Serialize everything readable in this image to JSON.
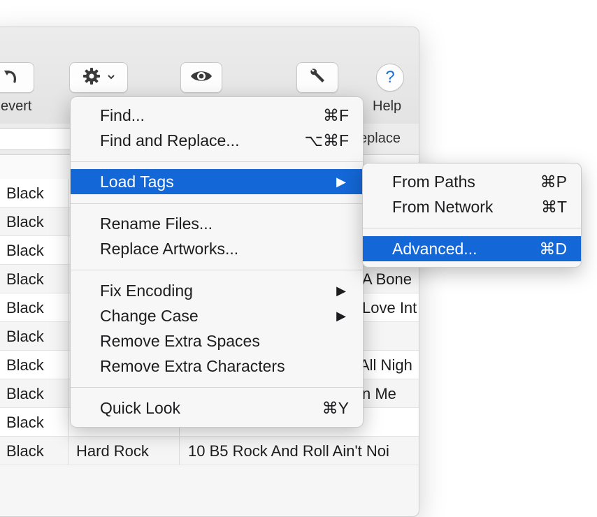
{
  "toolbar": {
    "revert_label": "evert",
    "help_label": "Help",
    "help_glyph": "?"
  },
  "search": {
    "replace_label": "eplace"
  },
  "table": {
    "rows": [
      {
        "c1": "Black",
        "c2": "",
        "c3": ""
      },
      {
        "c1": "Black",
        "c2": "",
        "c3": ""
      },
      {
        "c1": "Black",
        "c2": "",
        "c3": ""
      },
      {
        "c1": "Black",
        "c2": "",
        "c3": "A Bone"
      },
      {
        "c1": "Black",
        "c2": "",
        "c3": "Love Int"
      },
      {
        "c1": "Black",
        "c2": "",
        "c3": ""
      },
      {
        "c1": "Black",
        "c2": "",
        "c3": "All Nigh"
      },
      {
        "c1": "Black",
        "c2": "",
        "c3": "n Me"
      },
      {
        "c1": "Black",
        "c2": "",
        "c3": ""
      },
      {
        "c1": "Black",
        "c2": "Hard Rock",
        "c3": "10 B5 Rock And Roll Ain't Noi"
      }
    ]
  },
  "menu": {
    "find": {
      "label": "Find...",
      "shortcut": "⌘F"
    },
    "find_replace": {
      "label": "Find and Replace...",
      "shortcut": "⌥⌘F"
    },
    "load_tags": {
      "label": "Load Tags",
      "arrow": "▶"
    },
    "rename_files": {
      "label": "Rename Files..."
    },
    "replace_artworks": {
      "label": "Replace Artworks..."
    },
    "fix_encoding": {
      "label": "Fix Encoding",
      "arrow": "▶"
    },
    "change_case": {
      "label": "Change Case",
      "arrow": "▶"
    },
    "remove_spaces": {
      "label": "Remove Extra Spaces"
    },
    "remove_chars": {
      "label": "Remove Extra Characters"
    },
    "quick_look": {
      "label": "Quick Look",
      "shortcut": "⌘Y"
    }
  },
  "submenu": {
    "from_paths": {
      "label": "From Paths",
      "shortcut": "⌘P"
    },
    "from_network": {
      "label": "From Network",
      "shortcut": "⌘T"
    },
    "advanced": {
      "label": "Advanced...",
      "shortcut": "⌘D"
    }
  },
  "colors": {
    "highlight": "#1467d6",
    "help_blue": "#1a6fd8"
  },
  "icons": [
    "undo-icon",
    "gear-icon",
    "chevron-down-icon",
    "eye-icon",
    "wrench-icon",
    "help-icon",
    "submenu-arrow-icon"
  ]
}
